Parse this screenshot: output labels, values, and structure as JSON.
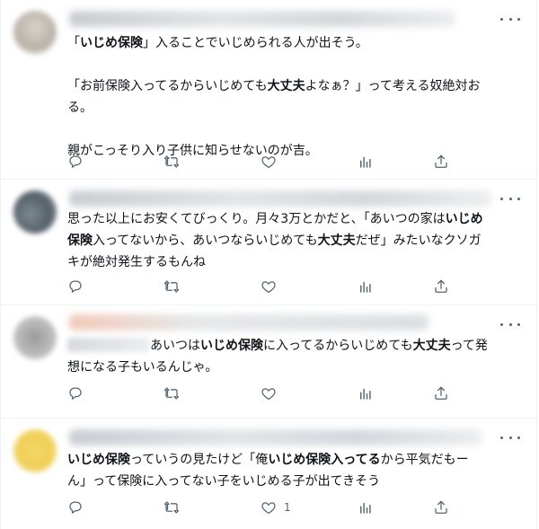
{
  "tweets": [
    {
      "paragraphs": [
        [
          {
            "t": "「"
          },
          {
            "t": "いじめ保険",
            "b": true
          },
          {
            "t": "」入ることでいじめられる人が出そう。"
          }
        ],
        [
          {
            "t": "「お前保険入ってるからいじめても"
          },
          {
            "t": "大丈夫",
            "b": true
          },
          {
            "t": "よなぁ？」って考える奴絶対お"
          },
          {
            "t": "\n"
          },
          {
            "t": "る。"
          }
        ],
        [
          {
            "t": "親がこっそり入り子供に知らせないのが吉。"
          }
        ]
      ],
      "like_count": ""
    },
    {
      "paragraphs": [
        [
          {
            "t": "思った以上にお安くてびっくり。月々3万とかだと、「あいつの家は"
          },
          {
            "t": "いじめ",
            "b": true
          },
          {
            "t": "\n"
          },
          {
            "t": "保険",
            "b": true
          },
          {
            "t": "入ってないから、あいつならいじめても"
          },
          {
            "t": "大丈夫",
            "b": true
          },
          {
            "t": "だぜ」みたいなクソガ"
          },
          {
            "t": "\n"
          },
          {
            "t": "キが絶対発生するもんね"
          }
        ]
      ],
      "like_count": ""
    },
    {
      "paragraphs": [
        [
          {
            "t": "あいつは"
          },
          {
            "t": "いじめ保険",
            "b": true
          },
          {
            "t": "に入ってるからいじめても"
          },
          {
            "t": "大丈夫",
            "b": true
          },
          {
            "t": "って発"
          },
          {
            "t": "\n"
          },
          {
            "t": "想になる子もいるんじゃ。"
          }
        ]
      ],
      "like_count": ""
    },
    {
      "paragraphs": [
        [
          {
            "t": "いじめ保険",
            "b": true
          },
          {
            "t": "っていうの見たけど「俺"
          },
          {
            "t": "いじめ保険入ってる",
            "b": true
          },
          {
            "t": "から平気だもー"
          },
          {
            "t": "\n"
          },
          {
            "t": "ん」って保険に入ってない子をいじめる子が出てきそう"
          }
        ]
      ],
      "like_count": "1"
    }
  ],
  "icons": [
    "reply-icon",
    "retweet-icon",
    "like-icon",
    "views-icon",
    "share-icon",
    "more-icon"
  ],
  "colors": {
    "icon": "#536471",
    "text": "#0f1419",
    "border": "#eff3f4"
  }
}
